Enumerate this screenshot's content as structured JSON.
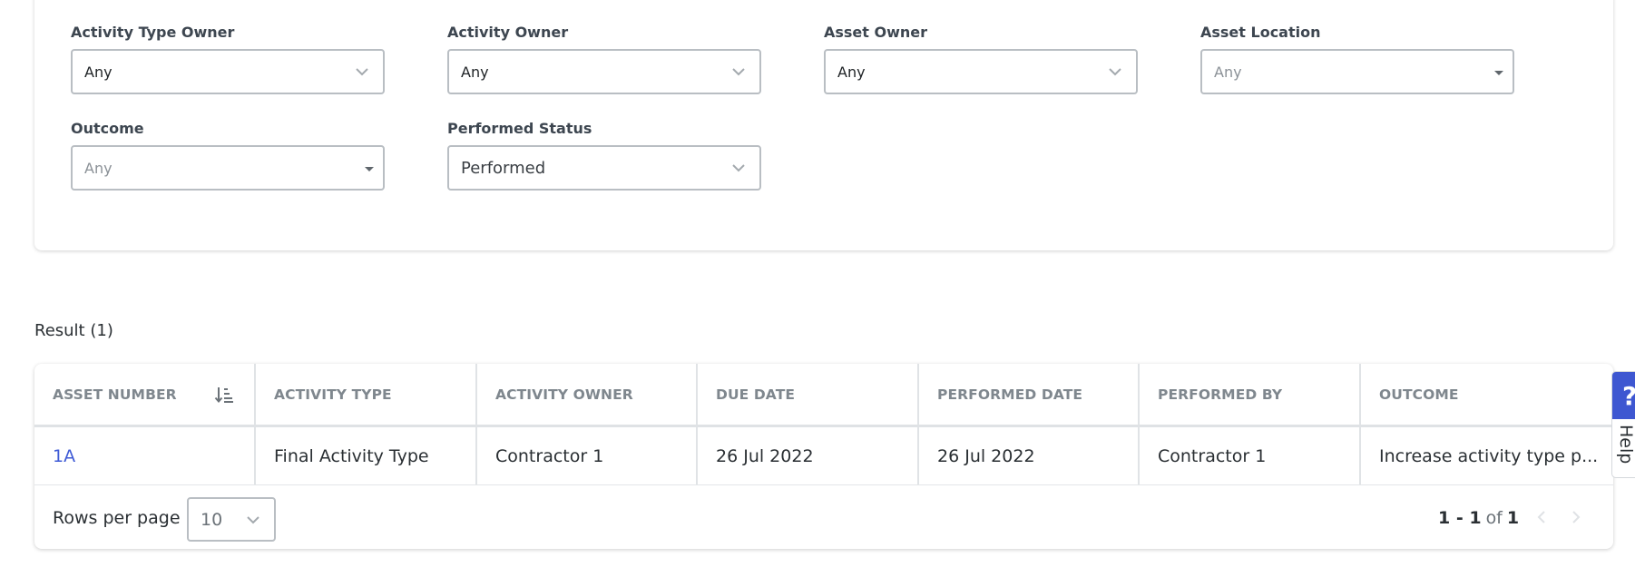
{
  "filters": {
    "activity_type_owner": {
      "label": "Activity Type Owner",
      "value": "Any"
    },
    "activity_owner": {
      "label": "Activity Owner",
      "value": "Any"
    },
    "asset_owner": {
      "label": "Asset Owner",
      "value": "Any"
    },
    "asset_location": {
      "label": "Asset Location",
      "value": "Any"
    },
    "outcome": {
      "label": "Outcome",
      "value": "Any"
    },
    "performed_status": {
      "label": "Performed Status",
      "value": "Performed"
    }
  },
  "result": {
    "title": "Result (1)"
  },
  "table": {
    "columns": [
      "ASSET NUMBER",
      "ACTIVITY TYPE",
      "ACTIVITY OWNER",
      "DUE DATE",
      "PERFORMED DATE",
      "PERFORMED BY",
      "OUTCOME"
    ],
    "rows": [
      {
        "asset_number": "1A",
        "activity_type": "Final Activity Type",
        "activity_owner": "Contractor 1",
        "due_date": "26 Jul 2022",
        "performed_date": "26 Jul 2022",
        "performed_by": "Contractor 1",
        "outcome": "Increase activity type p..."
      }
    ]
  },
  "pagination": {
    "rows_per_page_label": "Rows per page",
    "rows_per_page_value": "10",
    "range": "1 - 1",
    "of_label": "of",
    "total": "1"
  },
  "help": {
    "icon": "?",
    "label": "Help"
  },
  "colors": {
    "accent": "#3e57d1",
    "link": "#3f5bd6",
    "border": "#b9bec3"
  }
}
